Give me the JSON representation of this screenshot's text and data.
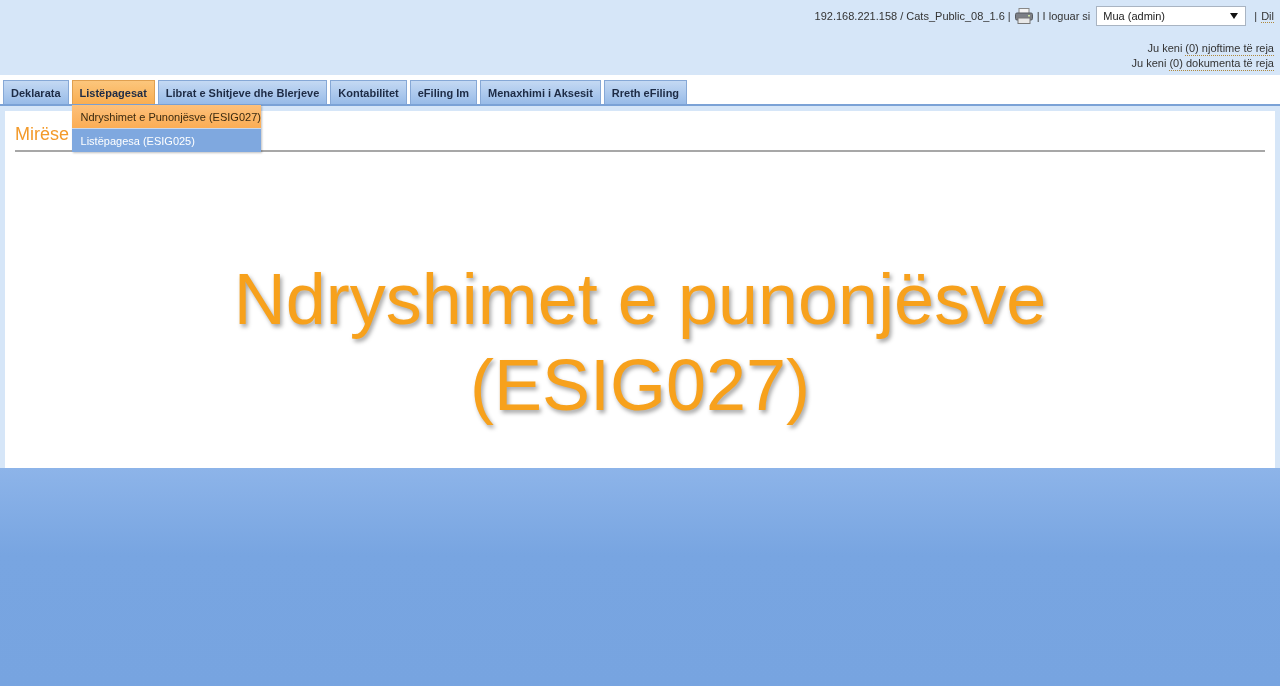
{
  "header": {
    "server_info": "192.168.221.158 / Cats_Public_08_1.6 |",
    "login_label": "| I loguar si",
    "user_select": {
      "value": "Mua (admin)"
    },
    "separator": "|",
    "logout": "Dil",
    "notices": [
      {
        "prefix": "Ju keni",
        "link": "(0) njoftime të reja"
      },
      {
        "prefix": "Ju keni",
        "link": "(0) dokumenta të reja"
      }
    ]
  },
  "tabs": [
    {
      "label": "Deklarata",
      "selected": false
    },
    {
      "label": "Listëpagesat",
      "selected": true,
      "menu": [
        {
          "label": "Ndryshimet e Punonjësve (ESIG027)",
          "selected": true
        },
        {
          "label": "Listëpagesa (ESIG025)",
          "selected": false
        }
      ]
    },
    {
      "label": "Librat e Shitjeve dhe Blerjeve",
      "selected": false
    },
    {
      "label": "Kontabilitet",
      "selected": false
    },
    {
      "label": "eFiling Im",
      "selected": false
    },
    {
      "label": "Menaxhimi i Aksesit",
      "selected": false
    },
    {
      "label": "Rreth eFiling",
      "selected": false
    }
  ],
  "panel": {
    "heading": "Mirëse",
    "banner": "Ndryshimet e punonjësve (ESIG027)"
  }
}
